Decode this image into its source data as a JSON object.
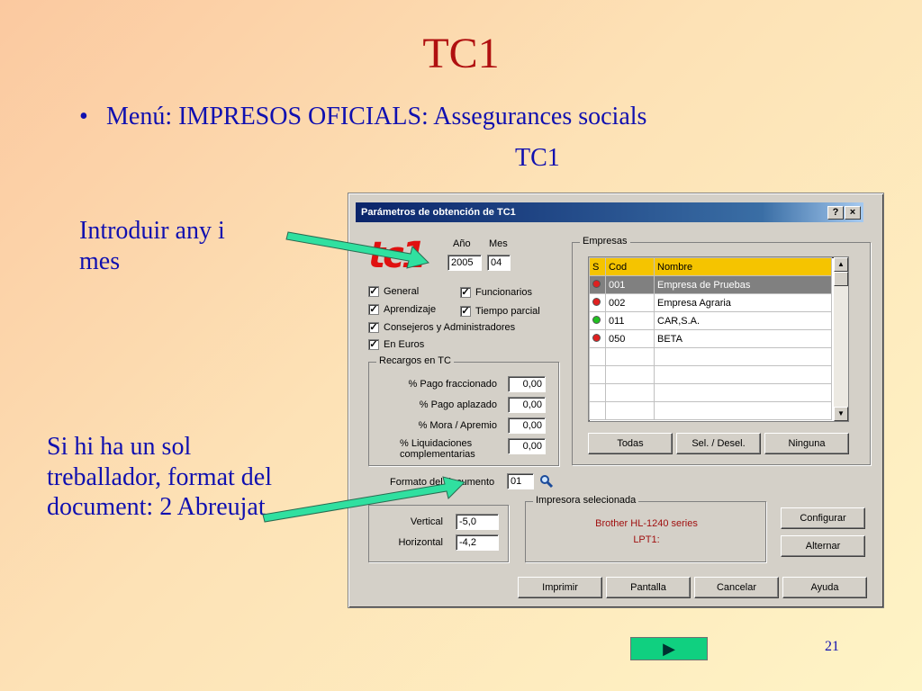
{
  "slide": {
    "title": "TC1",
    "bullet_char": "•",
    "bullet": "Menú: IMPRESOS OFICIALS: Assegurances socials",
    "subline": "TC1",
    "note_year": "Introduir any i mes",
    "note_format": "Si hi ha un sol treballador, format del document: 2 Abreujat",
    "page_number": "21",
    "next_icon": "▶"
  },
  "dialog": {
    "title": "Parámetros de obtención de TC1",
    "help_button": "?",
    "close_button": "×",
    "logo": "tc1",
    "year_label": "Año",
    "month_label": "Mes",
    "year_value": "2005",
    "month_value": "04",
    "checkboxes": {
      "general": "General",
      "funcionarios": "Funcionarios",
      "aprendizaje": "Aprendizaje",
      "tiempo_parcial": "Tiempo parcial",
      "consejeros": "Consejeros y Administradores",
      "en_euros": "En Euros",
      "check_mark": "✓"
    },
    "recargos": {
      "legend": "Recargos en TC",
      "pago_fraccionado_label": "% Pago fraccionado",
      "pago_fraccionado": "0,00",
      "pago_aplazado_label": "% Pago aplazado",
      "pago_aplazado": "0,00",
      "mora_label": "% Mora / Apremio",
      "mora": "0,00",
      "liquidaciones_label_1": "% Liquidaciones",
      "liquidaciones_label_2": "complementarias",
      "liquidaciones": "0,00"
    },
    "empresas": {
      "legend": "Empresas",
      "headers": [
        "S",
        "Cod",
        "Nombre"
      ],
      "rows": [
        {
          "status": "red",
          "cod": "001",
          "nombre": "Empresa de Pruebas"
        },
        {
          "status": "red",
          "cod": "002",
          "nombre": "Empresa Agraria"
        },
        {
          "status": "green",
          "cod": "011",
          "nombre": "CAR,S.A."
        },
        {
          "status": "red",
          "cod": "050",
          "nombre": "BETA"
        }
      ],
      "btn_todas": "Todas",
      "btn_sel": "Sel. / Desel.",
      "btn_ninguna": "Ninguna"
    },
    "formato_label": "Formato del documento",
    "formato_value": "01",
    "offsets": {
      "vertical_label": "Vertical",
      "vertical": "-5,0",
      "horizontal_label": "Horizontal",
      "horizontal": "-4,2"
    },
    "impresora": {
      "legend": "Impresora selecionada",
      "name": "Brother HL-1240 series",
      "port": "LPT1:"
    },
    "btn_configurar": "Configurar",
    "btn_alternar": "Alternar",
    "btn_imprimir": "Imprimir",
    "btn_pantalla": "Pantalla",
    "btn_cancelar": "Cancelar",
    "btn_ayuda": "Ayuda"
  },
  "colors": {
    "title": "#b01010",
    "text": "#1010b0",
    "arrow": "#30e0a0",
    "led_red": "#e02020",
    "led_green": "#20c020",
    "grid_header": "#f5c400"
  }
}
